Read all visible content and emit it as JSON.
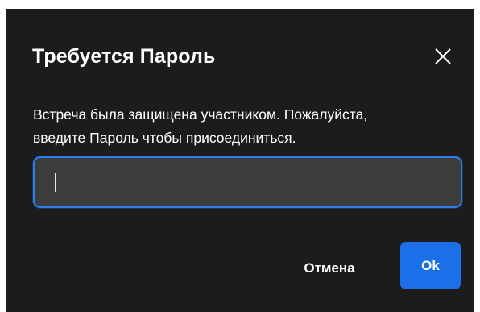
{
  "dialog": {
    "title": "Требуется Пароль",
    "close_icon": "close-icon",
    "message_lines": [
      "Встреча была защищена участником. Пожалуйста,",
      "введите Пароль чтобы присоединиться."
    ],
    "password": {
      "value": "",
      "placeholder": ""
    },
    "cancel_label": "Отмена",
    "ok_label": "Ok"
  },
  "colors": {
    "dialog_background": "#1c1c1c",
    "input_background": "#3c3c3c",
    "focus_border": "#2d7cf0",
    "primary_button": "#1c6fe8",
    "text": "#ffffff"
  }
}
